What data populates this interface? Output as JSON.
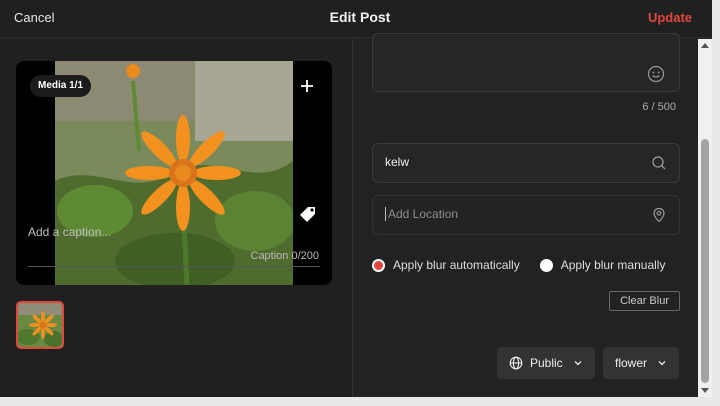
{
  "header": {
    "cancel_label": "Cancel",
    "title": "Edit Post",
    "update_label": "Update"
  },
  "media": {
    "badge": "Media 1/1",
    "add_icon": "plus-icon",
    "tag_icon": "tag-icon",
    "caption_placeholder": "Add a caption...",
    "caption_counter": "Caption 0/200"
  },
  "description": {
    "counter": "6 / 500",
    "emoji_icon": "smiley-icon"
  },
  "search": {
    "value": "kelw",
    "icon": "search-icon"
  },
  "location": {
    "placeholder": "Add Location",
    "icon": "location-pin-icon"
  },
  "blur": {
    "auto_label": "Apply blur automatically",
    "manual_label": "Apply blur manually",
    "selected": "auto",
    "clear_label": "Clear Blur"
  },
  "privacy": {
    "selected": "Public",
    "icon": "globe-icon"
  },
  "category": {
    "selected": "flower"
  },
  "colors": {
    "accent": "#e2473c",
    "background": "#222222"
  }
}
